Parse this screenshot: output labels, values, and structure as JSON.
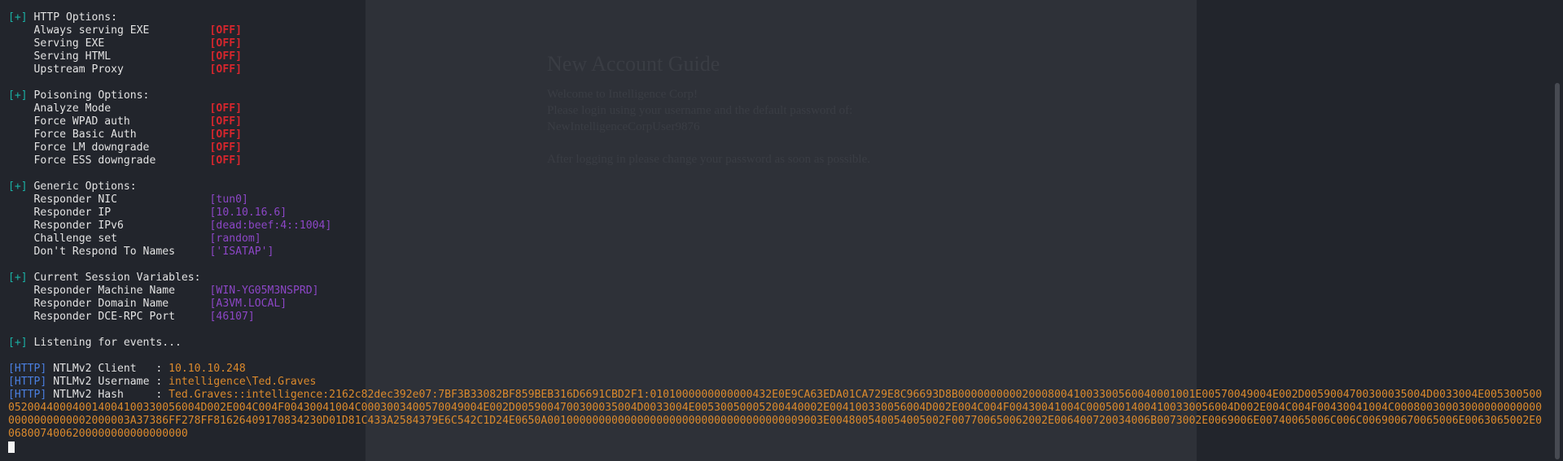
{
  "background_doc": {
    "title": "New Account Guide",
    "lines": [
      "Welcome to Intelligence Corp!",
      "Please login using your username and the default password of:",
      "NewIntelligenceCorpUser9876",
      "After logging in please change your password as soon as possible."
    ]
  },
  "terminal": {
    "http_options": {
      "header_tag": "[+]",
      "header": "HTTP Options:",
      "items": [
        {
          "label": "Always serving EXE",
          "value": "[OFF]"
        },
        {
          "label": "Serving EXE",
          "value": "[OFF]"
        },
        {
          "label": "Serving HTML",
          "value": "[OFF]"
        },
        {
          "label": "Upstream Proxy",
          "value": "[OFF]"
        }
      ]
    },
    "poisoning_options": {
      "header_tag": "[+]",
      "header": "Poisoning Options:",
      "items": [
        {
          "label": "Analyze Mode",
          "value": "[OFF]"
        },
        {
          "label": "Force WPAD auth",
          "value": "[OFF]"
        },
        {
          "label": "Force Basic Auth",
          "value": "[OFF]"
        },
        {
          "label": "Force LM downgrade",
          "value": "[OFF]"
        },
        {
          "label": "Force ESS downgrade",
          "value": "[OFF]"
        }
      ]
    },
    "generic_options": {
      "header_tag": "[+]",
      "header": "Generic Options:",
      "items": [
        {
          "label": "Responder NIC",
          "value": "[tun0]"
        },
        {
          "label": "Responder IP",
          "value": "[10.10.16.6]"
        },
        {
          "label": "Responder IPv6",
          "value": "[dead:beef:4::1004]"
        },
        {
          "label": "Challenge set",
          "value": "[random]"
        },
        {
          "label": "Don't Respond To Names",
          "value": "['ISATAP']"
        }
      ]
    },
    "session_variables": {
      "header_tag": "[+]",
      "header": "Current Session Variables:",
      "items": [
        {
          "label": "Responder Machine Name",
          "value": "[WIN-YG05M3NSPRD]"
        },
        {
          "label": "Responder Domain Name",
          "value": "[A3VM.LOCAL]"
        },
        {
          "label": "Responder DCE-RPC Port",
          "value": "[46107]"
        }
      ]
    },
    "listening": {
      "tag": "[+]",
      "text": "Listening for events..."
    },
    "captures": [
      {
        "tag": "[HTTP]",
        "label": "NTLMv2 Client   : ",
        "value": "10.10.10.248"
      },
      {
        "tag": "[HTTP]",
        "label": "NTLMv2 Username : ",
        "value": "intelligence\\Ted.Graves"
      },
      {
        "tag": "[HTTP]",
        "label": "NTLMv2 Hash     : ",
        "value": "Ted.Graves::intelligence:2162c82dec392e07:7BF3B33082BF859BEB316D6691CBD2F1:0101000000000000432E0E9CA63EDA01CA729E8C96693D8B0000000000200080041003300560040001001E00570049004E002D0059004700300035004D0033004E005300500052004400040014004100330056004D002E004C004F00430041004C0003003400570049004E002D0059004700300035004D0033004E00530050005200440002E004100330056004D002E004C004F00430041004C00050014004100330056004D002E004C004F00430041004C000800300030000000000000000000000002000003A37386FF278FF81626409170834230D01D81C433A2584379E6C542C1D24E0650A0010000000000000000000000000000000000009003E004800540054005002F007700650062002E006400720034006B0073002E0069006E00740065006C006C006900670065006E0063065002E00680074006200000000000000000"
      }
    ]
  },
  "colors": {
    "tag": "#1ab0a4",
    "http_tag": "#4a7fe0",
    "off": "#d7262d",
    "option_value": "#8c46c6",
    "capture_value": "#dc8a2c"
  }
}
